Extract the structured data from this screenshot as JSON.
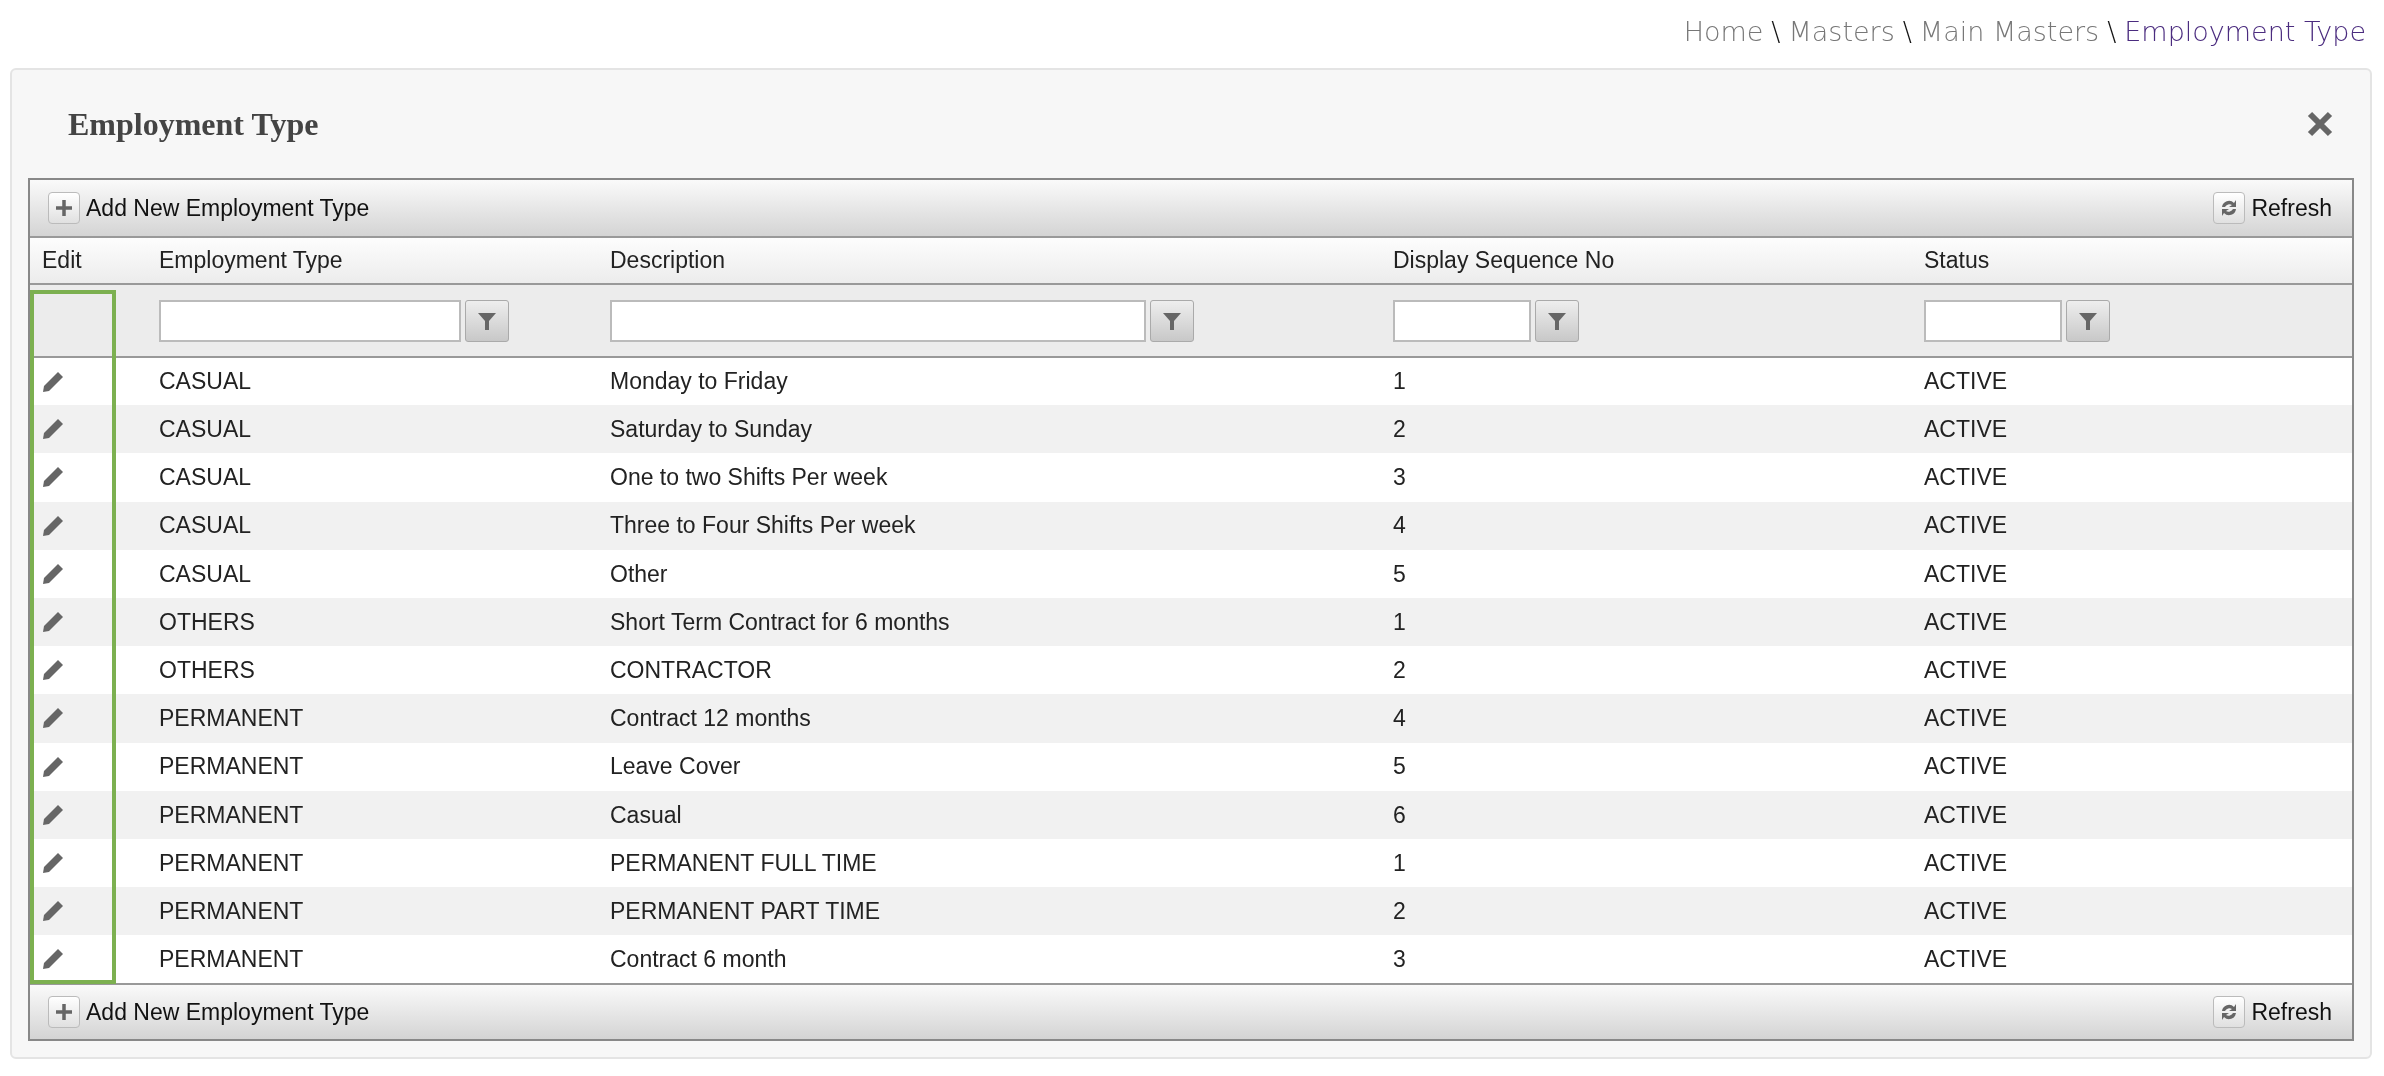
{
  "breadcrumb": [
    {
      "label": "Home",
      "current": false
    },
    {
      "label": "Masters",
      "current": false
    },
    {
      "label": "Main Masters",
      "current": false
    },
    {
      "label": "Employment Type",
      "current": true
    }
  ],
  "breadcrumb_separator": "\\",
  "panel": {
    "title": "Employment Type"
  },
  "toolbar_top": {
    "add_label": "Add New Employment Type",
    "refresh_label": "Refresh"
  },
  "table": {
    "columns": [
      {
        "label": "Edit",
        "filter": false
      },
      {
        "label": "Employment Type",
        "filter": true
      },
      {
        "label": "Description",
        "filter": true
      },
      {
        "label": "Display Sequence No",
        "filter": true
      },
      {
        "label": "Status",
        "filter": true
      }
    ],
    "edit_column_highlighted": true,
    "rows": [
      {
        "employment_type": "CASUAL",
        "description": "Monday to Friday",
        "sequence": "1",
        "status": "ACTIVE"
      },
      {
        "employment_type": "CASUAL",
        "description": "Saturday to Sunday",
        "sequence": "2",
        "status": "ACTIVE"
      },
      {
        "employment_type": "CASUAL",
        "description": "One to two Shifts Per week",
        "sequence": "3",
        "status": "ACTIVE"
      },
      {
        "employment_type": "CASUAL",
        "description": "Three to Four Shifts Per week",
        "sequence": "4",
        "status": "ACTIVE"
      },
      {
        "employment_type": "CASUAL",
        "description": "Other",
        "sequence": "5",
        "status": "ACTIVE"
      },
      {
        "employment_type": "OTHERS",
        "description": "Short Term Contract for 6 months",
        "sequence": "1",
        "status": "ACTIVE"
      },
      {
        "employment_type": "OTHERS",
        "description": "CONTRACTOR",
        "sequence": "2",
        "status": "ACTIVE"
      },
      {
        "employment_type": "PERMANENT",
        "description": "Contract 12 months",
        "sequence": "4",
        "status": "ACTIVE"
      },
      {
        "employment_type": "PERMANENT",
        "description": "Leave Cover",
        "sequence": "5",
        "status": "ACTIVE"
      },
      {
        "employment_type": "PERMANENT",
        "description": "Casual",
        "sequence": "6",
        "status": "ACTIVE"
      },
      {
        "employment_type": "PERMANENT",
        "description": "PERMANENT FULL TIME",
        "sequence": "1",
        "status": "ACTIVE"
      },
      {
        "employment_type": "PERMANENT",
        "description": "PERMANENT PART TIME",
        "sequence": "2",
        "status": "ACTIVE"
      },
      {
        "employment_type": "PERMANENT",
        "description": "Contract 6 month",
        "sequence": "3",
        "status": "ACTIVE"
      }
    ]
  },
  "toolbar_bottom": {
    "add_label": "Add New Employment Type",
    "refresh_label": "Refresh"
  }
}
